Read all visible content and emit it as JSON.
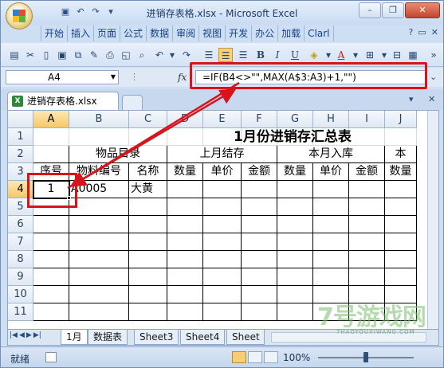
{
  "window": {
    "title": "进销存表格.xlsx - Microsoft Excel"
  },
  "ribbon_tabs": [
    "开始",
    "插入",
    "页面",
    "公式",
    "数据",
    "审阅",
    "视图",
    "开发",
    "办公",
    "加载",
    "Clarl"
  ],
  "formula_bar": {
    "name_box": "A4",
    "fx_label": "fx",
    "formula": "=IF(B4<>\"\",MAX(A$3:A3)+1,\"\")"
  },
  "workbook_tab": {
    "label": "进销存表格.xlsx"
  },
  "columns": [
    "A",
    "B",
    "C",
    "D",
    "E",
    "F",
    "G",
    "H",
    "I",
    "J"
  ],
  "rows": [
    "1",
    "2",
    "3",
    "4",
    "5",
    "6",
    "7",
    "8",
    "9",
    "10",
    "11"
  ],
  "sheet": {
    "title": "1月份进销存汇总表",
    "group_headers": [
      "物品目录",
      "上月结存",
      "本月入库",
      "本"
    ],
    "col_headers": [
      "序号",
      "物料编号",
      "名称",
      "数量",
      "单价",
      "金额",
      "数量",
      "单价",
      "金额",
      "数量"
    ],
    "row4": {
      "seq": "1",
      "code": "A0005",
      "name": "大黄"
    },
    "active_cell": "A4"
  },
  "sheet_tabs": [
    "1月",
    "数据表",
    "Sheet3",
    "Sheet4",
    "Sheet"
  ],
  "status": {
    "ready": "就绪",
    "zoom": "100%"
  },
  "watermark": {
    "text": "7号游戏网",
    "sub": "7HAOYOUXIWANG.COM"
  }
}
